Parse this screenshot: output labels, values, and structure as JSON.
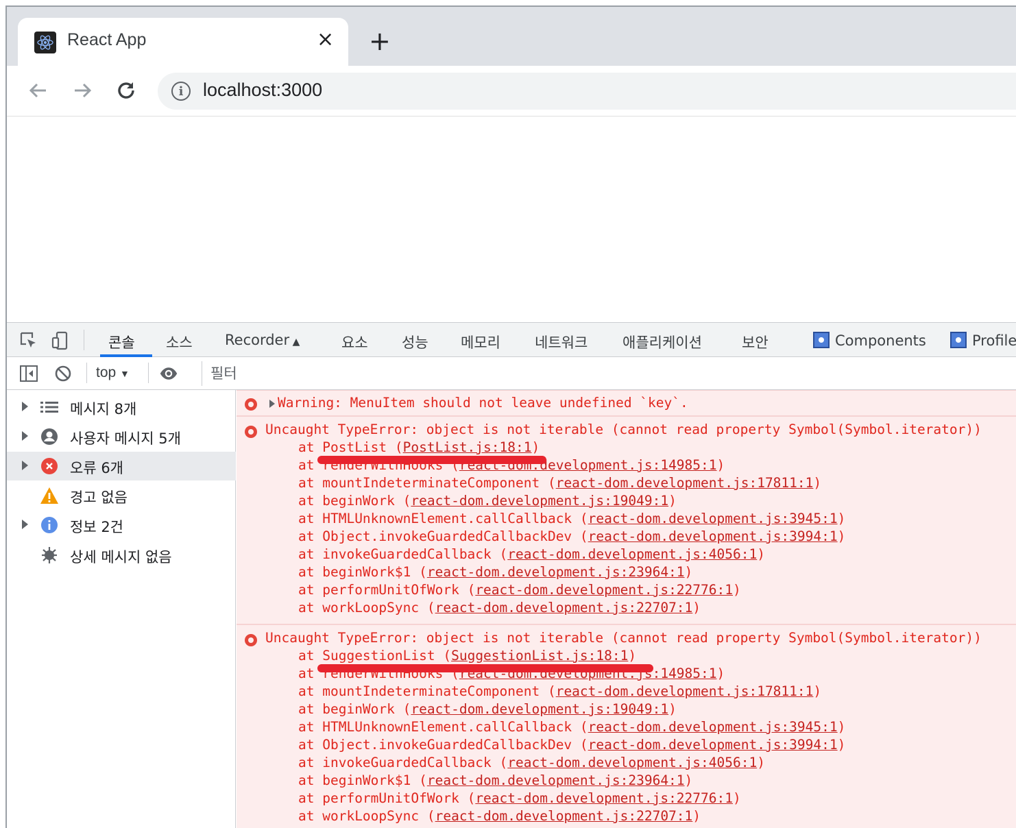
{
  "browser": {
    "tab_title": "React App",
    "tab_close": "×",
    "new_tab": "+",
    "url": "localhost:3000"
  },
  "devtools": {
    "tabs": [
      "콘솔",
      "소스",
      "Recorder",
      "요소",
      "성능",
      "메모리",
      "네트워크",
      "애플리케이션",
      "보안",
      "Components",
      "Profiler"
    ],
    "active_tab": "콘솔",
    "context": "top",
    "filter_placeholder": "필터",
    "sidebar": [
      {
        "label": "메시지 8개",
        "icon": "list-icon"
      },
      {
        "label": "사용자 메시지 5개",
        "icon": "user-icon"
      },
      {
        "label": "오류 6개",
        "icon": "error-icon"
      },
      {
        "label": "경고 없음",
        "icon": "warning-icon"
      },
      {
        "label": "정보 2건",
        "icon": "info-icon"
      },
      {
        "label": "상세 메시지 없음",
        "icon": "bug-icon"
      }
    ],
    "messages": [
      {
        "type": "warning-collapsed",
        "text": "Warning: MenuItem should not leave undefined `key`."
      },
      {
        "type": "error",
        "text": "Uncaught TypeError: object is not iterable (cannot read property Symbol(Symbol.iterator))",
        "frames": [
          {
            "fn": "PostList",
            "loc": "PostList.js:18:1"
          },
          {
            "fn": "renderWithHooks",
            "loc": "react-dom.development.js:14985:1"
          },
          {
            "fn": "mountIndeterminateComponent",
            "loc": "react-dom.development.js:17811:1"
          },
          {
            "fn": "beginWork",
            "loc": "react-dom.development.js:19049:1"
          },
          {
            "fn": "HTMLUnknownElement.callCallback",
            "loc": "react-dom.development.js:3945:1"
          },
          {
            "fn": "Object.invokeGuardedCallbackDev",
            "loc": "react-dom.development.js:3994:1"
          },
          {
            "fn": "invokeGuardedCallback",
            "loc": "react-dom.development.js:4056:1"
          },
          {
            "fn": "beginWork$1",
            "loc": "react-dom.development.js:23964:1"
          },
          {
            "fn": "performUnitOfWork",
            "loc": "react-dom.development.js:22776:1"
          },
          {
            "fn": "workLoopSync",
            "loc": "react-dom.development.js:22707:1"
          }
        ]
      },
      {
        "type": "error",
        "text": "Uncaught TypeError: object is not iterable (cannot read property Symbol(Symbol.iterator))",
        "frames": [
          {
            "fn": "SuggestionList",
            "loc": "SuggestionList.js:18:1"
          },
          {
            "fn": "renderWithHooks",
            "loc": "react-dom.development.js:14985:1"
          },
          {
            "fn": "mountIndeterminateComponent",
            "loc": "react-dom.development.js:17811:1"
          },
          {
            "fn": "beginWork",
            "loc": "react-dom.development.js:19049:1"
          },
          {
            "fn": "HTMLUnknownElement.callCallback",
            "loc": "react-dom.development.js:3945:1"
          },
          {
            "fn": "Object.invokeGuardedCallbackDev",
            "loc": "react-dom.development.js:3994:1"
          },
          {
            "fn": "invokeGuardedCallback",
            "loc": "react-dom.development.js:4056:1"
          },
          {
            "fn": "beginWork$1",
            "loc": "react-dom.development.js:23964:1"
          },
          {
            "fn": "performUnitOfWork",
            "loc": "react-dom.development.js:22776:1"
          },
          {
            "fn": "workLoopSync",
            "loc": "react-dom.development.js:22707:1"
          }
        ]
      }
    ],
    "frame_prefix": "at",
    "colors": {
      "error_text": "#e0271e",
      "error_bg": "#fdeded",
      "highlight_mark": "#e8242e",
      "active_tab_underline": "#1a73e8"
    }
  }
}
